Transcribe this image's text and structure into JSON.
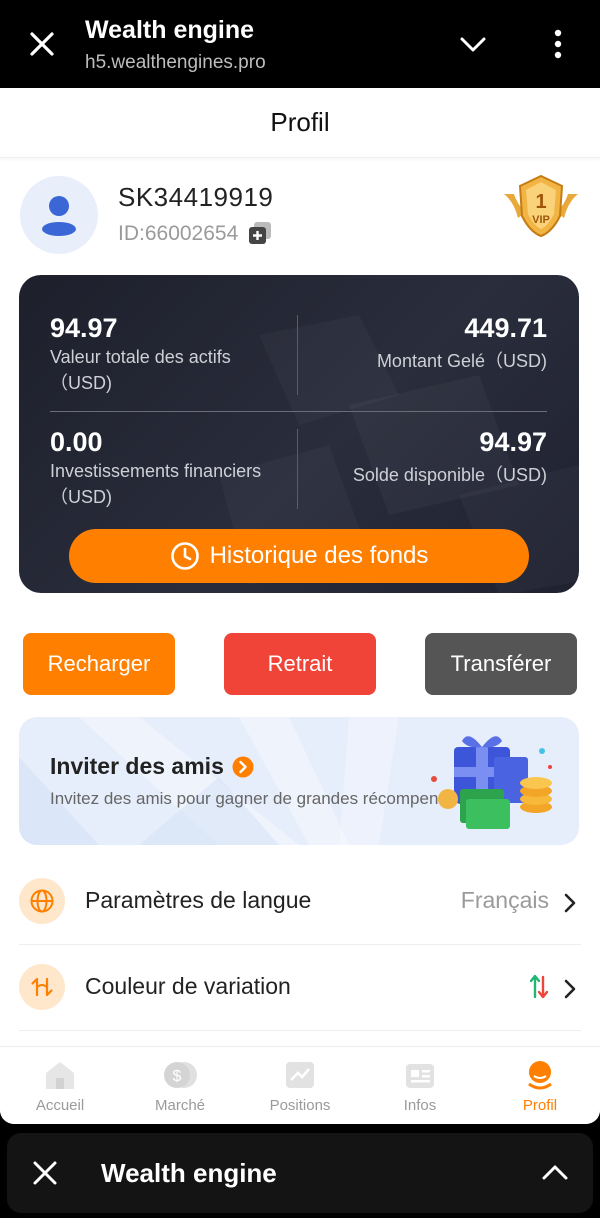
{
  "browser": {
    "title": "Wealth engine",
    "url": "h5.wealthengines.pro"
  },
  "page": {
    "title": "Profil"
  },
  "profile": {
    "username": "SK34419919",
    "id_text": "ID:66002654",
    "vip_level": "1",
    "vip_label": "VIP"
  },
  "assets": {
    "total_value": "94.97",
    "total_label": "Valeur totale des actifs\n（USD)",
    "frozen_value": "449.71",
    "frozen_label": "Montant Gelé（USD)",
    "investments_value": "0.00",
    "investments_label": "Investissements financiers\n（USD)",
    "available_value": "94.97",
    "available_label": "Solde disponible（USD)",
    "history_button": "Historique des fonds"
  },
  "actions": {
    "recharge": "Recharger",
    "withdraw": "Retrait",
    "transfer": "Transférer"
  },
  "invite": {
    "title": "Inviter des amis",
    "subtitle": "Invitez des amis pour gagner de grandes récompenses !"
  },
  "settings": {
    "language_label": "Paramètres de langue",
    "language_value": "Français",
    "color_label": "Couleur de variation"
  },
  "tabs": {
    "home": "Accueil",
    "market": "Marché",
    "positions": "Positions",
    "news": "Infos",
    "profile": "Profil"
  },
  "bottom_bar": {
    "title": "Wealth engine"
  },
  "colors": {
    "accent": "#ff7f00",
    "withdraw": "#f04438",
    "transfer": "#555555",
    "card_bg": "#23252f"
  }
}
